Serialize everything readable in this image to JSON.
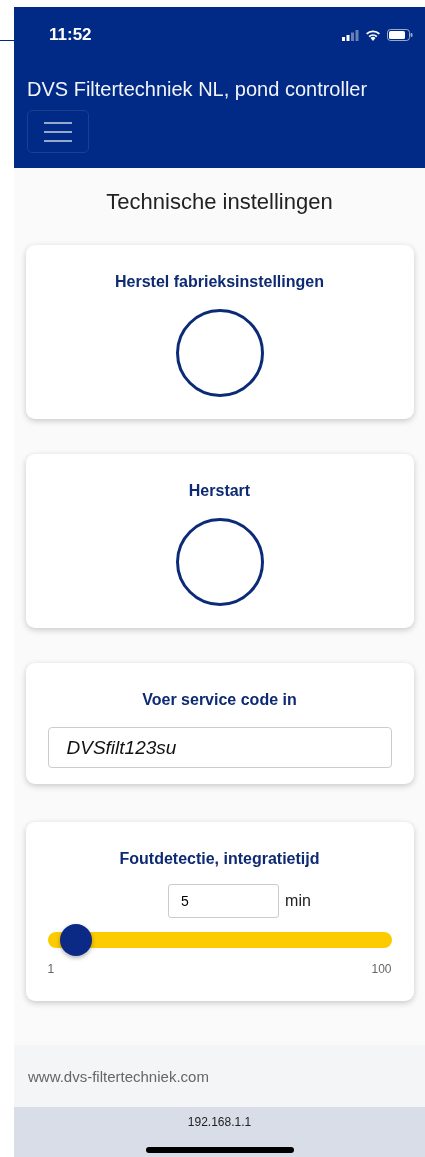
{
  "status_bar": {
    "time": "11:52"
  },
  "header": {
    "title": "DVS Filtertechniek NL, pond controller"
  },
  "page": {
    "heading": "Technische instellingen"
  },
  "cards": [
    {
      "kind": "action",
      "title": "Herstel fabrieksinstellingen"
    },
    {
      "kind": "action",
      "title": "Herstart"
    },
    {
      "kind": "code",
      "title": "Voer service code in",
      "value": "DVSfilt123su"
    },
    {
      "kind": "slider",
      "title": "Foutdetectie, integratietijd",
      "value": "5",
      "unit": "min",
      "level": 0.04,
      "min_label": "1",
      "max_label": "100"
    }
  ],
  "footer": {
    "link": "www.dvs-filtertechniek.com"
  },
  "address_bar": {
    "url": "192.168.1.1"
  }
}
